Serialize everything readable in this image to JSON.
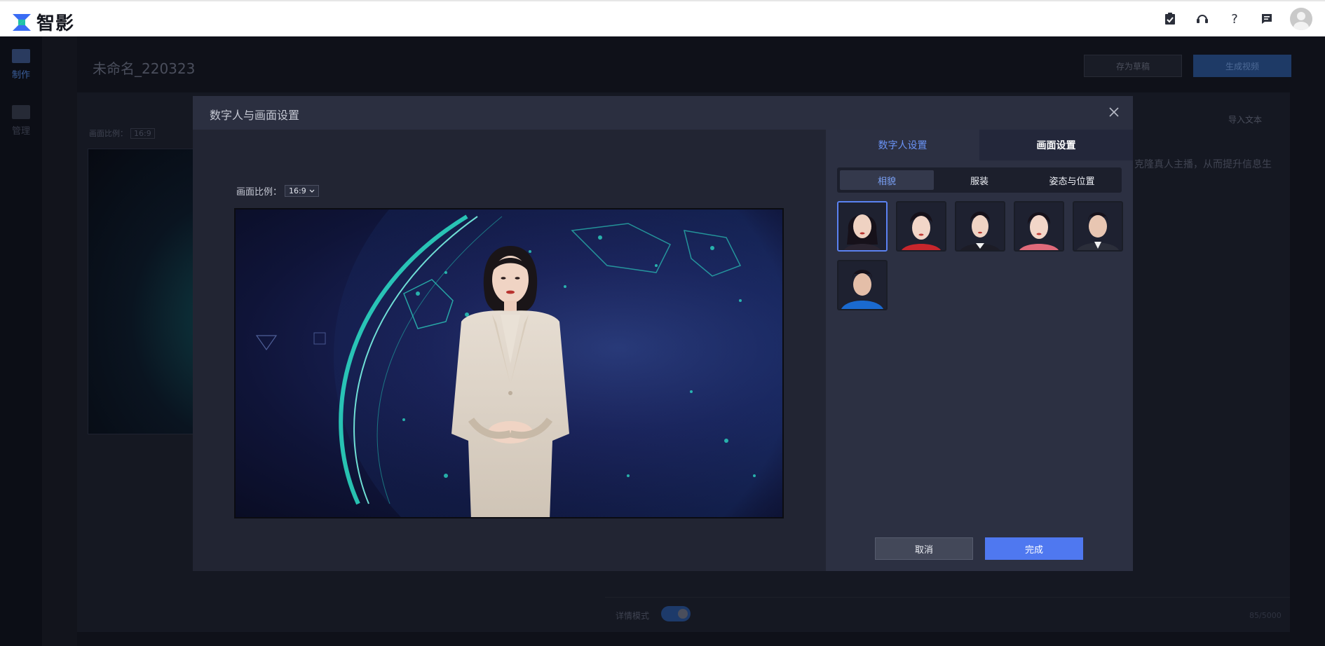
{
  "topbar": {
    "brand": "智影",
    "icons": [
      "clipboard-check-icon",
      "headset-icon",
      "help-icon",
      "message-icon"
    ],
    "help_glyph": "?"
  },
  "sidebar": {
    "items": [
      {
        "label": "制作",
        "icon": "film-icon"
      },
      {
        "label": "管理",
        "icon": "folder-icon"
      }
    ]
  },
  "editor": {
    "project_title": "未命名_220323",
    "save_draft_label": "存为草稿",
    "generate_label": "生成视频",
    "ratio_label": "画面比例：",
    "ratio_value": "16:9",
    "import_text_label": "导入文本",
    "hint_text": "克隆真人主播，从而提升信息生",
    "detail_mode_label": "详情模式",
    "char_count": "85/5000"
  },
  "modal": {
    "title": "数字人与画面设置",
    "ratio_label": "画面比例：",
    "ratio_value": "16:9",
    "tabs": [
      {
        "label": "数字人设置",
        "active": true
      },
      {
        "label": "画面设置",
        "active": false
      }
    ],
    "subtabs": [
      {
        "label": "相貌",
        "active": true
      },
      {
        "label": "服装",
        "active": false
      },
      {
        "label": "姿态与位置",
        "active": false
      }
    ],
    "faces_count": 6,
    "selected_face": 1,
    "cancel_label": "取消",
    "done_label": "完成"
  },
  "colors": {
    "accent": "#4f78f0",
    "active_tab_text": "#6a93f5",
    "modal_bg": "#222533",
    "panel_bg": "#2c3042"
  }
}
